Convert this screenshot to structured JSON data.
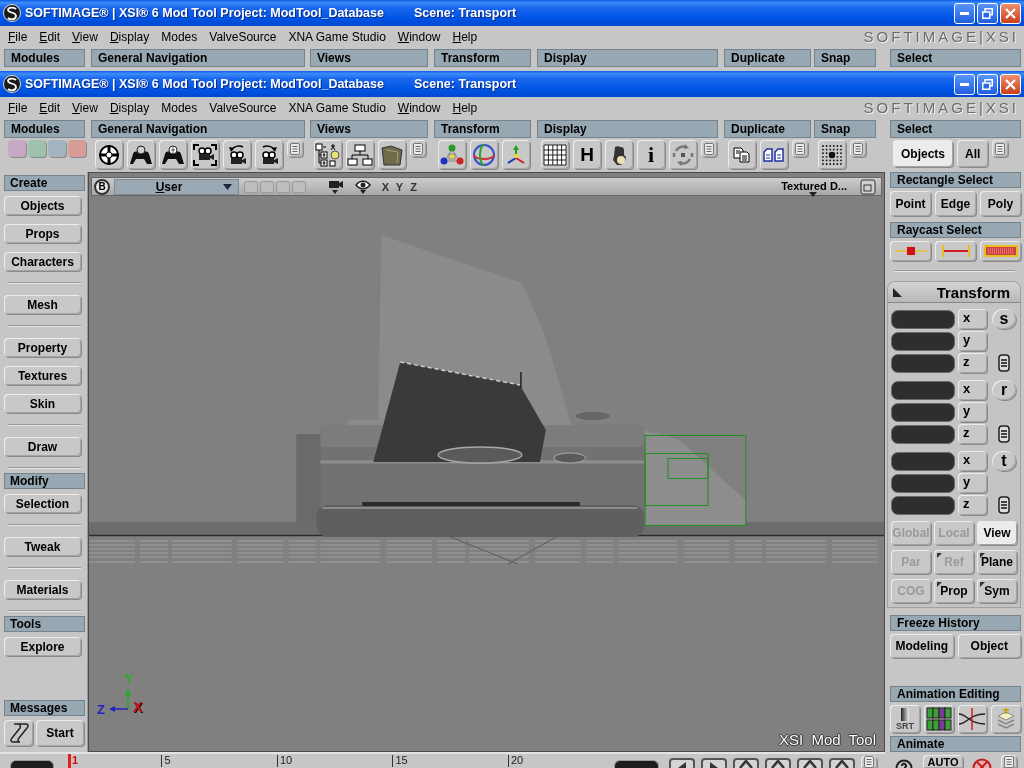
{
  "background_window": {
    "title": "SOFTIMAGE® | XSI® 6 Mod Tool Project: ModTool_Database",
    "scene": "Scene: Transport",
    "menu": [
      {
        "label": "File",
        "mnemonic": true
      },
      {
        "label": "Edit",
        "mnemonic": true
      },
      {
        "label": "View",
        "mnemonic": true
      },
      {
        "label": "Display",
        "mnemonic": true
      },
      {
        "label": "Modes",
        "mnemonic": false
      },
      {
        "label": "ValveSource",
        "mnemonic": false
      },
      {
        "label": "XNA Game Studio",
        "mnemonic": false
      },
      {
        "label": "Window",
        "mnemonic": true
      },
      {
        "label": "Help",
        "mnemonic": true
      }
    ],
    "brand": "SOFTIMAGE|XSI",
    "toolbar_groups": [
      "Modules",
      "General Navigation",
      "Views",
      "Transform",
      "Display",
      "Duplicate",
      "Snap",
      "Select"
    ]
  },
  "window": {
    "title": "SOFTIMAGE® | XSI® 6 Mod Tool Project: ModTool_Database",
    "scene": "Scene: Transport",
    "menu": [
      {
        "label": "File",
        "mnemonic": true
      },
      {
        "label": "Edit",
        "mnemonic": true
      },
      {
        "label": "View",
        "mnemonic": true
      },
      {
        "label": "Display",
        "mnemonic": true
      },
      {
        "label": "Modes",
        "mnemonic": false
      },
      {
        "label": "ValveSource",
        "mnemonic": false
      },
      {
        "label": "XNA Game Studio",
        "mnemonic": false
      },
      {
        "label": "Window",
        "mnemonic": true
      },
      {
        "label": "Help",
        "mnemonic": true
      }
    ],
    "brand": "SOFTIMAGE|XSI",
    "toolbar_groups": [
      {
        "label": "Modules",
        "swatches": [
          {
            "color": "#c6a9c3"
          },
          {
            "color": "#9fc2ab"
          },
          {
            "color": "#a3b3c0"
          },
          {
            "color": "#d69d96"
          }
        ]
      },
      {
        "label": "General Navigation"
      },
      {
        "label": "Views"
      },
      {
        "label": "Transform"
      },
      {
        "label": "Display",
        "glyphs": [
          "H",
          "i"
        ]
      },
      {
        "label": "Duplicate"
      },
      {
        "label": "Snap"
      },
      {
        "label": "Select",
        "buttons": [
          {
            "label": "Objects",
            "selected": true
          },
          {
            "label": "All",
            "selected": false
          }
        ]
      }
    ],
    "sidebar": {
      "sections": [
        {
          "title": "Create",
          "groups": [
            [
              "Objects",
              "Props",
              "Characters"
            ],
            [
              "Mesh"
            ],
            [
              "Property",
              "Textures",
              "Skin"
            ],
            [
              "Draw"
            ]
          ]
        },
        {
          "title": "Modify",
          "groups": [
            [
              "Selection"
            ],
            [
              "Tweak"
            ],
            [
              "Materials"
            ]
          ]
        },
        {
          "title": "Tools",
          "groups": [
            [
              "Explore"
            ]
          ]
        }
      ],
      "messages": {
        "title": "Messages",
        "button": "Start"
      }
    },
    "viewport": {
      "badge": "B",
      "camera": {
        "label": "User",
        "mnemonic": true
      },
      "axis_toggles": [
        "X",
        "Y",
        "Z"
      ],
      "display_mode": "Textured D...",
      "axis_labels": [
        {
          "label": "Y",
          "color": "#22b022"
        },
        {
          "label": "Z",
          "color": "#2020c0"
        },
        {
          "label": "X",
          "color": "#c41414"
        }
      ],
      "overlay_text": "XSI Mod Tool"
    },
    "timeline": {
      "ticks": [
        {
          "label": "1",
          "current": true
        },
        {
          "label": "5",
          "current": false
        },
        {
          "label": "10",
          "current": false
        },
        {
          "label": "15",
          "current": false
        },
        {
          "label": "20",
          "current": false
        }
      ]
    },
    "right_panel": {
      "rectangle_select": {
        "title": "Rectangle Select",
        "buttons": [
          "Point",
          "Edge",
          "Poly"
        ]
      },
      "raycast_select": {
        "title": "Raycast Select"
      },
      "transform": {
        "title": "Transform",
        "groups": [
          {
            "mode": "s",
            "axes": [
              "x",
              "y",
              "z"
            ]
          },
          {
            "mode": "r",
            "axes": [
              "x",
              "y",
              "z"
            ]
          },
          {
            "mode": "t",
            "axes": [
              "x",
              "y",
              "z"
            ]
          }
        ],
        "reference_rows": [
          [
            {
              "label": "Global",
              "disabled": true,
              "selected": false,
              "has_options": false
            },
            {
              "label": "Local",
              "disabled": true,
              "selected": false,
              "has_options": false
            },
            {
              "label": "View",
              "disabled": false,
              "selected": true,
              "has_options": false
            }
          ],
          [
            {
              "label": "Par",
              "disabled": true,
              "selected": false,
              "has_options": false
            },
            {
              "label": "Ref",
              "disabled": true,
              "selected": false,
              "has_options": true
            },
            {
              "label": "Plane",
              "disabled": false,
              "selected": false,
              "has_options": true
            }
          ],
          [
            {
              "label": "COG",
              "disabled": true,
              "selected": false,
              "has_options": false
            },
            {
              "label": "Prop",
              "disabled": false,
              "selected": false,
              "has_options": true
            },
            {
              "label": "Sym",
              "disabled": false,
              "selected": false,
              "has_options": true
            }
          ]
        ]
      },
      "freeze_history": {
        "title": "Freeze History",
        "buttons": [
          "Modeling",
          "Object"
        ]
      },
      "animation_editing": {
        "title": "Animation Editing",
        "srt_button": "SRT"
      },
      "animate": {
        "title": "Animate",
        "auto_button": "AUTO"
      }
    }
  }
}
